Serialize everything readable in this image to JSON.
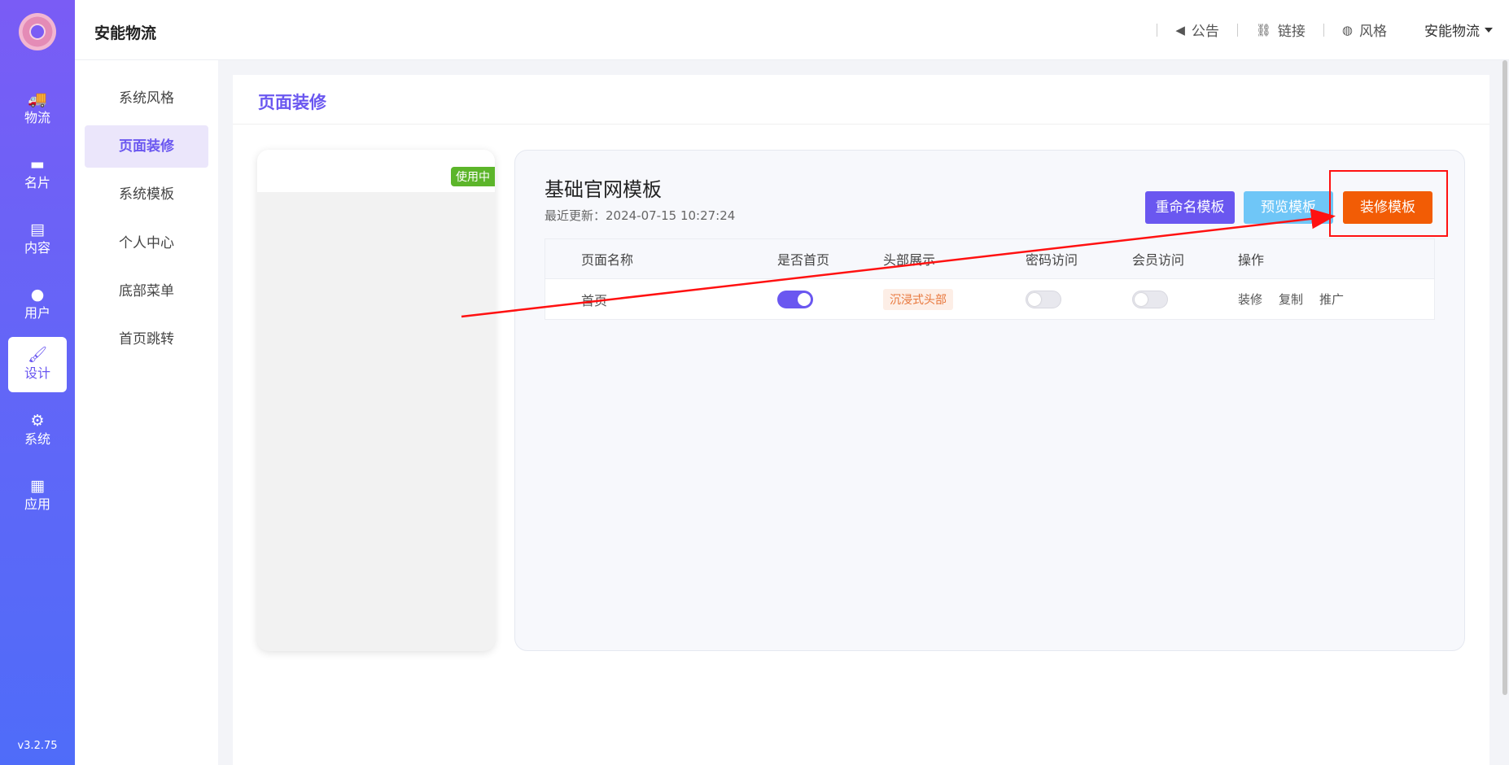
{
  "rail": {
    "items": [
      {
        "label": "物流",
        "icon": "truck-icon"
      },
      {
        "label": "名片",
        "icon": "card-icon"
      },
      {
        "label": "内容",
        "icon": "document-icon"
      },
      {
        "label": "用户",
        "icon": "user-icon"
      },
      {
        "label": "设计",
        "icon": "paint-roller-icon"
      },
      {
        "label": "系统",
        "icon": "gear-icon"
      },
      {
        "label": "应用",
        "icon": "grid-icon"
      }
    ],
    "active_index": 4,
    "version": "v3.2.75"
  },
  "header": {
    "brand": "安能物流",
    "links": [
      {
        "label": "公告",
        "icon": "megaphone-icon"
      },
      {
        "label": "链接",
        "icon": "link-icon"
      },
      {
        "label": "风格",
        "icon": "palette-icon"
      }
    ],
    "user": "安能物流"
  },
  "submenu": {
    "items": [
      "系统风格",
      "页面装修",
      "系统模板",
      "个人中心",
      "底部菜单",
      "首页跳转"
    ],
    "active_index": 1
  },
  "main": {
    "title": "页面装修",
    "phone_badge": "使用中",
    "template": {
      "name": "基础官网模板",
      "updated": "最近更新：2024-07-15 10:27:24",
      "buttons": {
        "rename": "重命名模板",
        "preview": "预览模板",
        "edit": "装修模板"
      }
    },
    "table": {
      "columns": [
        "页面名称",
        "是否首页",
        "头部展示",
        "密码访问",
        "会员访问",
        "操作"
      ],
      "rows": [
        {
          "name": "首页",
          "is_home": true,
          "header_style": "沉浸式头部",
          "password_access": false,
          "member_access": false,
          "actions": [
            "装修",
            "复制",
            "推广"
          ]
        }
      ]
    }
  },
  "colors": {
    "accent": "#6a57f0",
    "preview": "#6fc6f7",
    "edit": "#f25c05",
    "in_use": "#5cb52a",
    "annotation": "#ff1111"
  }
}
